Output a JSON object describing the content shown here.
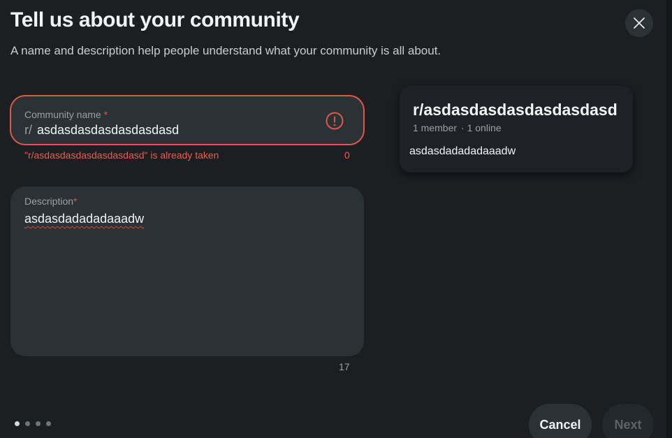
{
  "header": {
    "title": "Tell us about your community",
    "subtitle": "A name and description help people understand what your community is all about."
  },
  "name_field": {
    "label": "Community name",
    "required_marker": "*",
    "prefix": "r/",
    "value": "asdasdasdasdasdasdasd",
    "error": "\"r/asdasdasdasdasdasdasd\" is already taken",
    "char_count": "0"
  },
  "description_field": {
    "label": "Description",
    "required_marker": "*",
    "value": "asdasdadadadaaadw",
    "char_count": "17"
  },
  "preview": {
    "name": "r/asdasdasdasdasdasdasd",
    "members": "1 member",
    "online": "· 1 online",
    "description": "asdasdadadadaaadw"
  },
  "footer": {
    "steps_total": 4,
    "current_step": 1,
    "cancel_label": "Cancel",
    "next_label": "Next"
  },
  "colors": {
    "background": "#1b1f22",
    "field": "#2a3236",
    "error": "#e0574a",
    "muted_text": "#9aa1a5"
  }
}
